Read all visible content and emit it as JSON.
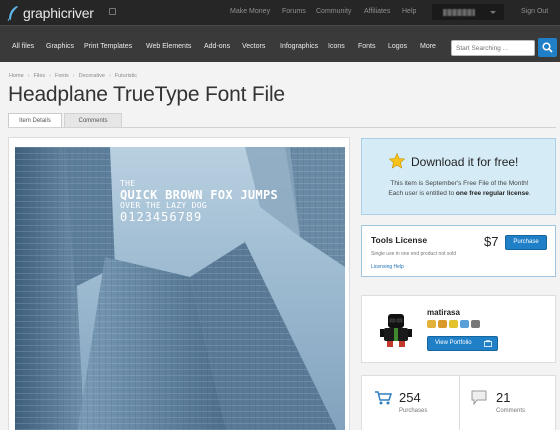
{
  "site": {
    "logo_text": "graphicriver",
    "logo_icon": "feather-logo-icon"
  },
  "topnav": {
    "links": [
      "Make Money",
      "Forums",
      "Community",
      "Affiliates",
      "Help"
    ],
    "signout": "Sign Out"
  },
  "catnav": {
    "items": [
      "All files",
      "Graphics",
      "Print Templates",
      "Web Elements",
      "Add-ons",
      "Vectors",
      "Infographics",
      "Icons",
      "Fonts",
      "Logos",
      "More"
    ],
    "search_placeholder": "Start Searching ..."
  },
  "breadcrumb": [
    "Home",
    "Files",
    "Fonts",
    "Decorative",
    "Futuristic"
  ],
  "page": {
    "title": "Headplane TrueType Font File",
    "tabs": [
      "Item Details",
      "Comments"
    ]
  },
  "preview": {
    "line1": "The",
    "line2": "Quick Brown Fox Jumps",
    "line3": "over the Lazy Dog",
    "line4": "0123456789"
  },
  "freefile": {
    "heading": "Download it for free!",
    "line1": "This item is September's Free File of the Month!",
    "line2_prefix": "Each user is entitled to ",
    "line2_bold": "one free regular license",
    "line2_suffix": "."
  },
  "license": {
    "title": "Tools License",
    "price": "$7",
    "purchase_label": "Purchase",
    "desc": "Single use in one end product not sold",
    "link": "Licensing Help"
  },
  "author": {
    "name": "matirasa",
    "portfolio_label": "View Portfolio"
  },
  "stats": {
    "purchases_count": "254",
    "purchases_label": "Purchases",
    "comments_count": "21",
    "comments_label": "Comments"
  },
  "colors": {
    "accent": "#1f7fc7",
    "header": "#262626",
    "nav": "#3a3a3a",
    "freefile_bg": "#d5ecf7"
  }
}
